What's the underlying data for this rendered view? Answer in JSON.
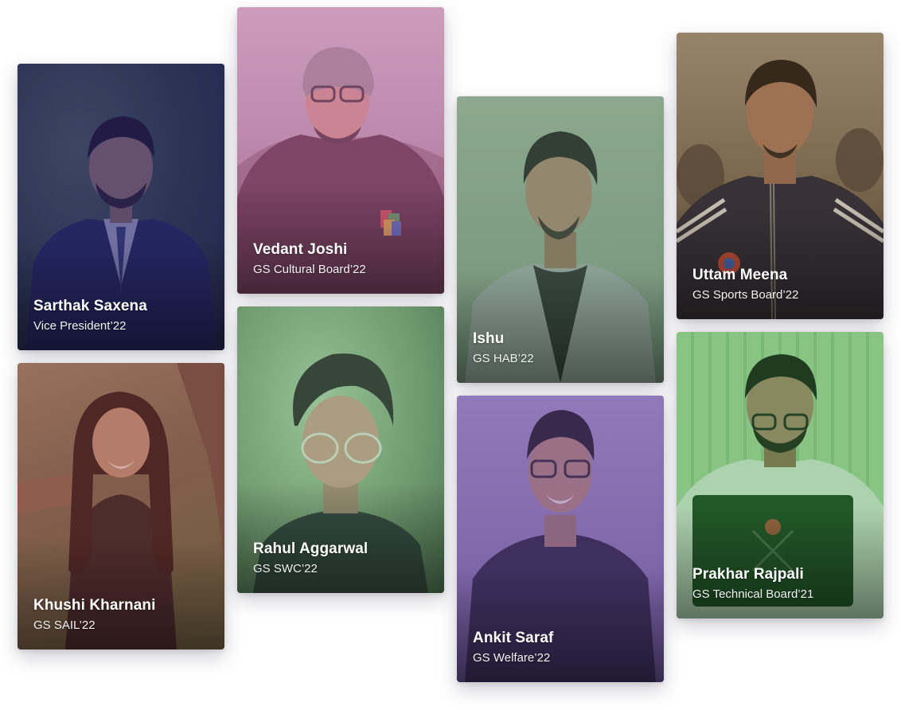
{
  "members": [
    {
      "name": "Sarthak Saxena",
      "role": "Vice President’22"
    },
    {
      "name": "Khushi Kharnani",
      "role": "GS SAIL’22"
    },
    {
      "name": "Vedant Joshi",
      "role": "GS Cultural Board’22"
    },
    {
      "name": "Rahul Aggarwal",
      "role": "GS SWC’22"
    },
    {
      "name": "Ishu",
      "role": "GS HAB’22"
    },
    {
      "name": "Ankit Saraf",
      "role": "GS Welfare’22"
    },
    {
      "name": "Uttam Meena",
      "role": "GS Sports Board’22"
    },
    {
      "name": "Prakhar Rajpali",
      "role": "GS Technical Board’21"
    }
  ],
  "colors": {
    "tint_navy": "#28226e",
    "tint_pink": "#d478b4",
    "tint_green": "#6e9678",
    "tint_purple": "#6e50aa",
    "tint_sepia": "#785a32",
    "tint_lime": "#3ca046"
  }
}
